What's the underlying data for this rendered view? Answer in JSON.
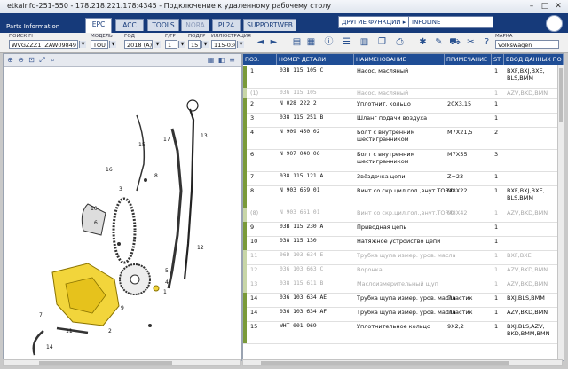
{
  "window": {
    "title": "etkainfo-251-550 - 178.218.221.178:4345 - Подключение к удаленному рабочему столу",
    "controls": [
      "–",
      "□",
      "✕"
    ]
  },
  "header": {
    "logo_top": "",
    "logo_bottom": "Parts Information",
    "tabs": [
      {
        "label": "EPC",
        "active": true
      },
      {
        "label": "ACC"
      },
      {
        "label": "TOOLS"
      },
      {
        "label": "NORA",
        "dim": true
      },
      {
        "label": "PL24"
      },
      {
        "label": "SUPPORTWEB"
      }
    ],
    "other_functions": "ДРУГИЕ ФУНКЦИИ ▸",
    "infoline": "INFOLINE"
  },
  "toolbar": {
    "search": {
      "label": "ПОИСК FI",
      "value": "WVGZZZ1TZAW09849"
    },
    "model": {
      "label": "МОДЕЛЬ",
      "value": "TOU"
    },
    "year": {
      "label": "ГОД",
      "value": "2018 (A)"
    },
    "group": {
      "label": "Г/ГР",
      "value": "1"
    },
    "subgroup": {
      "label": "ПОДГР",
      "value": "15"
    },
    "illustration": {
      "label": "ИЛЛЮСТРАЦИЯ",
      "value": "115-030"
    },
    "brand": {
      "label": "МАРКА",
      "value": "Volkswagen"
    }
  },
  "table": {
    "columns": [
      "ПОЗ.",
      "НОМЕР ДЕТАЛИ",
      "НАИМЕНОВАНИЕ",
      "ПРИМЕЧАНИЕ",
      "ST",
      "ВВОД ДАННЫХ ПО"
    ],
    "rows": [
      {
        "pos": "1",
        "part": "03B 115 105 C",
        "name": "Насос, масляный",
        "note": "",
        "st": "1",
        "data": "BXF,BXJ,BXE,|BLS,BMM",
        "dim": false,
        "mark": "#7a9a3a",
        "h": 2.5
      },
      {
        "pos": "(1)",
        "part": "03G 115 105",
        "name": "Насос, масляный",
        "note": "",
        "st": "1",
        "data": "AZV,BKD,BMN",
        "dim": true,
        "mark": "#c8d6a8",
        "h": 1
      },
      {
        "pos": "2",
        "part": "N  028 222 2",
        "name": "Уплотнит. кольцо",
        "note": "20X3,15",
        "st": "1",
        "data": "",
        "dim": false,
        "mark": "#7a9a3a",
        "h": 1.5
      },
      {
        "pos": "3",
        "part": "038 115 251 B",
        "name": "Шланг подачи воздуха",
        "note": "",
        "st": "1",
        "data": "",
        "dim": false,
        "mark": "#7a9a3a",
        "h": 1.5
      },
      {
        "pos": "4",
        "part": "N  909 450 02",
        "name": "Болт с внутренним|шестигранником",
        "note": "M7X21,5",
        "st": "2",
        "data": "",
        "dim": false,
        "mark": "#7a9a3a",
        "h": 2.5
      },
      {
        "pos": "6",
        "part": "N  907 040 06",
        "name": "Болт с внутренним|шестигранником",
        "note": "M7X55",
        "st": "3",
        "data": "",
        "dim": false,
        "mark": "#7a9a3a",
        "h": 2.5
      },
      {
        "pos": "7",
        "part": "038 115 121 A",
        "name": "Звёздочка цепи",
        "note": "Z=23",
        "st": "1",
        "data": "",
        "dim": false,
        "mark": "#7a9a3a",
        "h": 1.5
      },
      {
        "pos": "8",
        "part": "N  903 659 01",
        "name": "Винт со скр.цил.гол.,внут.TORX",
        "note": "M8X22",
        "st": "1",
        "data": "BXF,BXJ,BXE,|BLS,BMM",
        "dim": false,
        "mark": "#7a9a3a",
        "h": 2.5
      },
      {
        "pos": "(8)",
        "part": "N  903 661 01",
        "name": "Винт со скр.цил.гол.,внут.TORX",
        "note": "M8X42",
        "st": "1",
        "data": "AZV,BKD,BMN",
        "dim": true,
        "mark": "#c8d6a8",
        "h": 1.5
      },
      {
        "pos": "9",
        "part": "03B 115 230 A",
        "name": "Приводная цепь",
        "note": "",
        "st": "1",
        "data": "",
        "dim": false,
        "mark": "#7a9a3a",
        "h": 1.5
      },
      {
        "pos": "10",
        "part": "038 115 130",
        "name": "Натяжное устройство цепи",
        "note": "",
        "st": "1",
        "data": "",
        "dim": false,
        "mark": "#7a9a3a",
        "h": 1.5
      },
      {
        "pos": "11",
        "part": "06D 103 634 E",
        "name": "Трубка щупа измер. уров. масла",
        "note": "",
        "st": "1",
        "data": "BXF,BXE",
        "dim": true,
        "mark": "#c8d6a8",
        "h": 1.5
      },
      {
        "pos": "12",
        "part": "03G 103 663 C",
        "name": "Воронка",
        "note": "",
        "st": "1",
        "data": "AZV,BKD,BMN",
        "dim": true,
        "mark": "#c8d6a8",
        "h": 1.5
      },
      {
        "pos": "13",
        "part": "038 115 611 B",
        "name": "Маслоизмерительный щуп",
        "note": "",
        "st": "1",
        "data": "AZV,BKD,BMN",
        "dim": true,
        "mark": "#c8d6a8",
        "h": 1.5
      },
      {
        "pos": "14",
        "part": "03G 103 634 AE",
        "name": "Трубка щупа измер. уров. масла",
        "note": "Пластик",
        "st": "1",
        "data": "BXJ,BLS,BMM",
        "dim": false,
        "mark": "#7a9a3a",
        "h": 1.5
      },
      {
        "pos": "14",
        "part": "03G 103 634 AF",
        "name": "Трубка щупа измер. уров. масла",
        "note": "Пластик",
        "st": "1",
        "data": "AZV,BKD,BMN",
        "dim": false,
        "mark": "#7a9a3a",
        "h": 1.5
      },
      {
        "pos": "15",
        "part": "WHT 001 969",
        "name": "Уплотнительное кольцо",
        "note": "9X2,2",
        "st": "1",
        "data": "BXJ,BLS,AZV,|BKD,BMM,BMN",
        "dim": false,
        "mark": "#7a9a3a",
        "h": 2.5
      }
    ]
  },
  "diagram": {
    "callouts": [
      "1",
      "2",
      "3",
      "4",
      "5",
      "6",
      "7",
      "8",
      "9",
      "10",
      "11",
      "12",
      "13",
      "14",
      "15",
      "16",
      "17"
    ]
  }
}
